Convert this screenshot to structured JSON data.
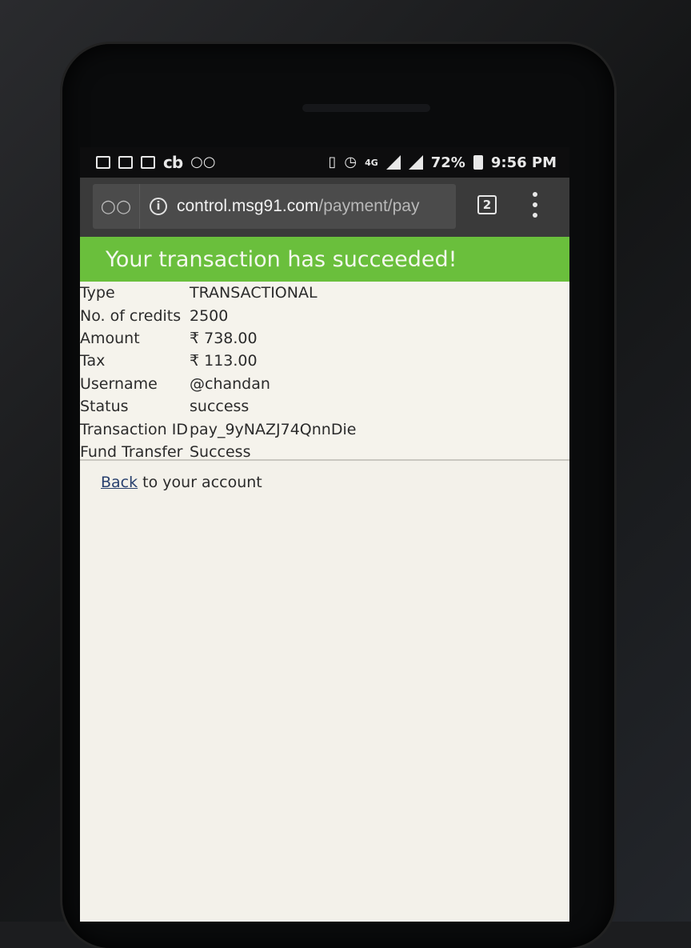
{
  "status_bar": {
    "icons_left": [
      "gallery-icon",
      "news-icon",
      "outlook-icon",
      "cb-icon",
      "incognito-icon"
    ],
    "cb_text": "cb",
    "network": "4G",
    "battery": "72%",
    "time": "9:56 PM"
  },
  "browser": {
    "url_host": "control.msg91.com",
    "url_path": "/payment/pay",
    "tab_count": "2"
  },
  "page": {
    "banner": "Your transaction has succeeded!",
    "rows": [
      {
        "label": "Type",
        "value": "TRANSACTIONAL"
      },
      {
        "label": "No. of credits",
        "value": "2500"
      },
      {
        "label": "Amount",
        "value": "₹ 738.00"
      },
      {
        "label": "Tax",
        "value": "₹ 113.00"
      },
      {
        "label": "Username",
        "value": "@chandan"
      },
      {
        "label": "Status",
        "value": "success"
      },
      {
        "label": "Transaction ID",
        "value": "pay_9yNAZJ74QnnDie"
      },
      {
        "label": "Fund Transfer",
        "value": "Success"
      }
    ],
    "back_link": "Back",
    "back_suffix": " to your account"
  },
  "colors": {
    "banner_bg": "#6abf3c",
    "toolbar_bg": "#3a3a3a",
    "link": "#28406e"
  }
}
